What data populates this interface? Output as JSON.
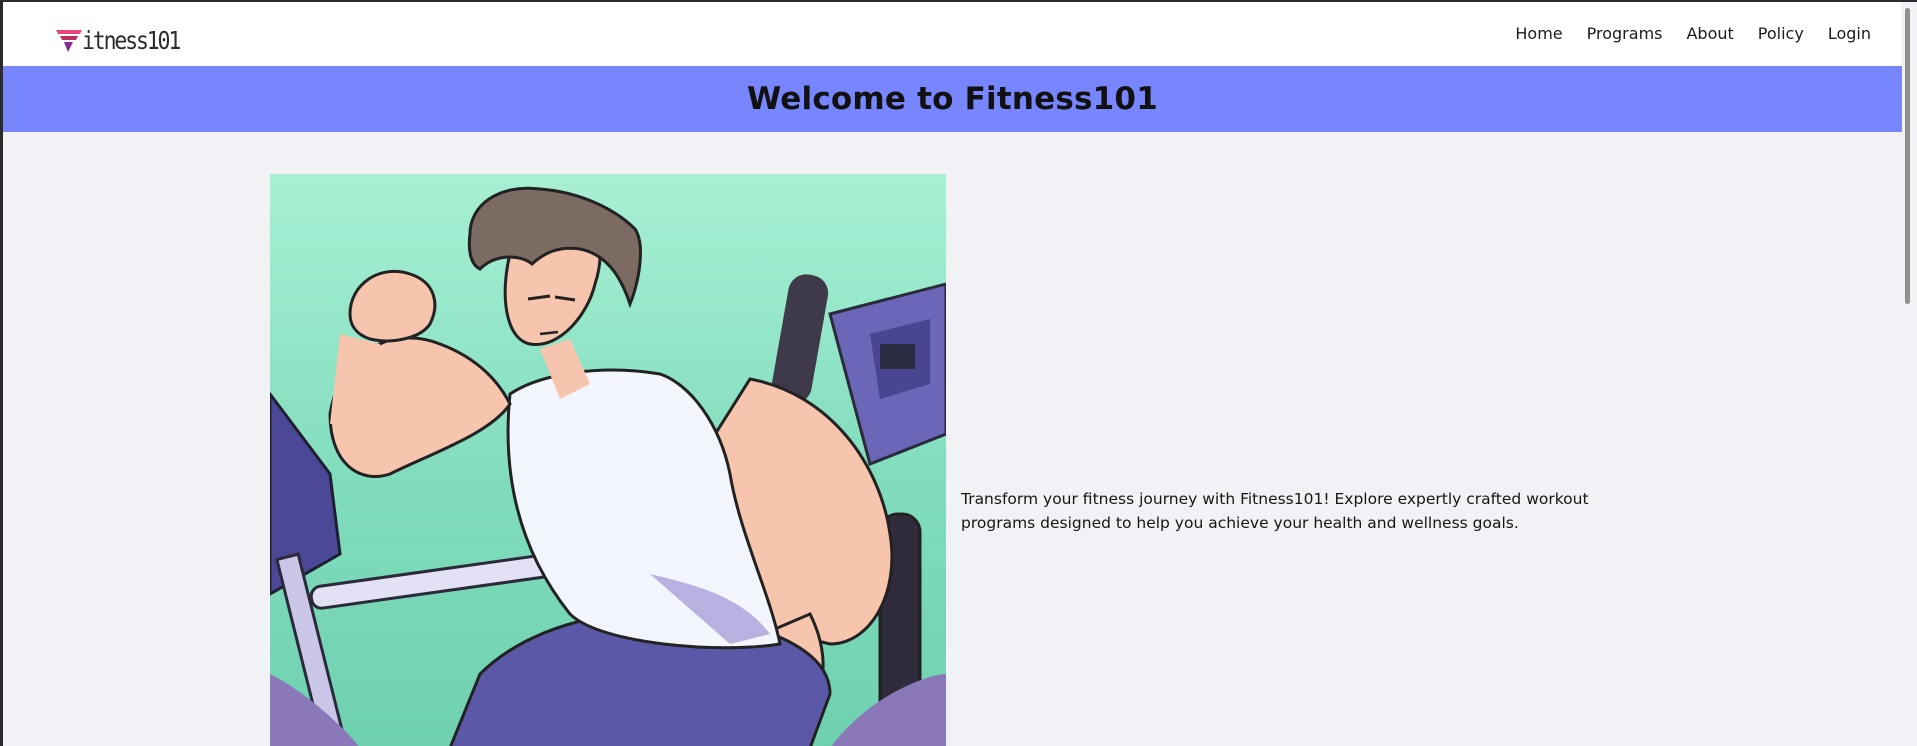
{
  "brand": {
    "logo_text": "itness101",
    "logo_colors": [
      "#e8467c",
      "#c0305f",
      "#7c2d8c"
    ]
  },
  "nav": {
    "items": [
      "Home",
      "Programs",
      "About",
      "Policy",
      "Login"
    ]
  },
  "banner": {
    "title": "Welcome to Fitness101",
    "background": "#7886fe"
  },
  "hero": {
    "image_icon": "fitness-illustration-icon",
    "description": "Transform your fitness journey with Fitness101! Explore expertly crafted workout programs designed to help you achieve your health and wellness goals."
  },
  "colors": {
    "page_background": "#f1f2f5",
    "navbar_background": "#ffffff"
  }
}
